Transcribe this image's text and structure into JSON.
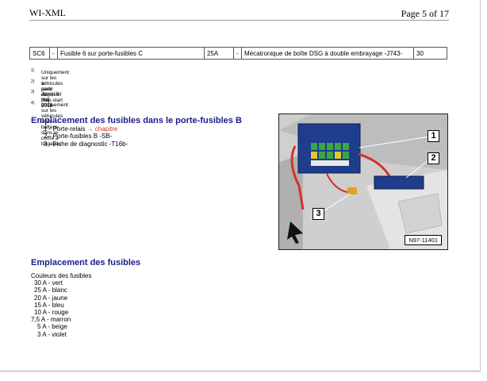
{
  "header": {
    "title": "WI-XML",
    "page": "Page 5 of 17"
  },
  "fuse_row": {
    "id": "SC6",
    "sep1": "-",
    "desc": "Fusible 6 sur porte-fusibles C",
    "amp": "25A",
    "sep2": "-",
    "consumer": "Mécatronique de boîte DSG à double embrayage -J743-",
    "num": "30"
  },
  "notes": [
    {
      "num": "1)",
      "text": "Uniquement sur les véhicules avec dispositif stop-start"
    },
    {
      "num": "2)",
      "text": "à partir de mai 2010"
    },
    {
      "num": "3)",
      "text": "Jusqu'à mai 2011"
    },
    {
      "num": "4)",
      "text": "uniquement sur les véhicules avec batterie dans le coffre à bagages"
    }
  ],
  "section1": {
    "title": "Emplacement des fusibles dans le porte-fusibles B",
    "items": [
      {
        "text": "1 - Porte-relais ",
        "link": "→ chapitre"
      },
      {
        "text": "2 - Porte-fusibles B -SB-"
      },
      {
        "text": "3 - Fiche de diagnostic -T16b-"
      }
    ]
  },
  "figure": {
    "callouts": [
      "1",
      "2",
      "3"
    ],
    "id": "N97-11401"
  },
  "section2": {
    "title": "Emplacement des fusibles",
    "intro": "Couleurs des fusibles",
    "colors": [
      "30 A - vert",
      "25 A - blanc",
      "20 A - jaune",
      "15 A - bleu",
      "10 A - rouge",
      "7,5 A - marron",
      "5 A - beige",
      "3 A - violet"
    ]
  }
}
